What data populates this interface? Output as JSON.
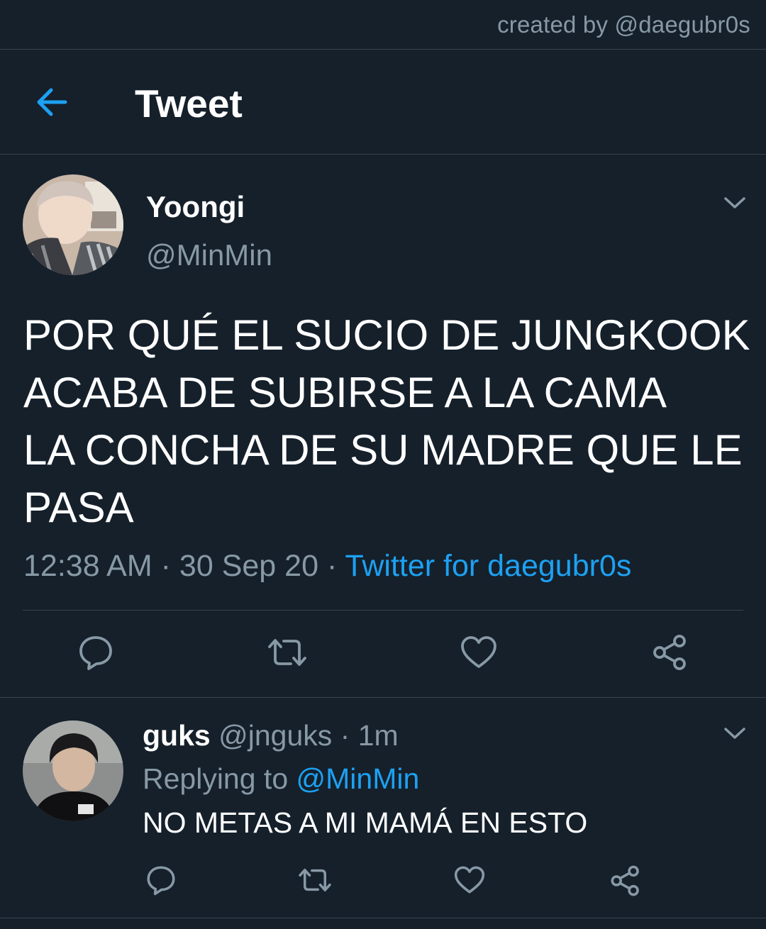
{
  "credit": "created by @daegubr0s",
  "header": {
    "title": "Tweet",
    "back_icon": "arrow-left-icon"
  },
  "colors": {
    "background": "#15202b",
    "accent": "#1da1f2",
    "muted": "#8899a6",
    "divider": "#38444d"
  },
  "tweet": {
    "author_name": "Yoongi",
    "author_handle": "@MinMin",
    "text": "POR QUÉ EL SUCIO DE JUNGKOOK\nACABA DE SUBIRSE A LA CAMA\nLA CONCHA DE SU MADRE QUE LE\nPASA",
    "time": "12:38 AM",
    "date": "30 Sep 20",
    "separator": "·",
    "source": "Twitter for daegubr0s",
    "actions": [
      "reply-icon",
      "retweet-icon",
      "like-icon",
      "share-icon"
    ]
  },
  "reply": {
    "author_name": "guks",
    "author_handle": "@jnguks",
    "separator": "·",
    "time": "1m",
    "replying_to_label": "Replying to",
    "replying_to_handle": "@MinMin",
    "text": "NO METAS A MI MAMÁ EN ESTO",
    "actions": [
      "reply-icon",
      "retweet-icon",
      "like-icon",
      "share-icon"
    ]
  }
}
